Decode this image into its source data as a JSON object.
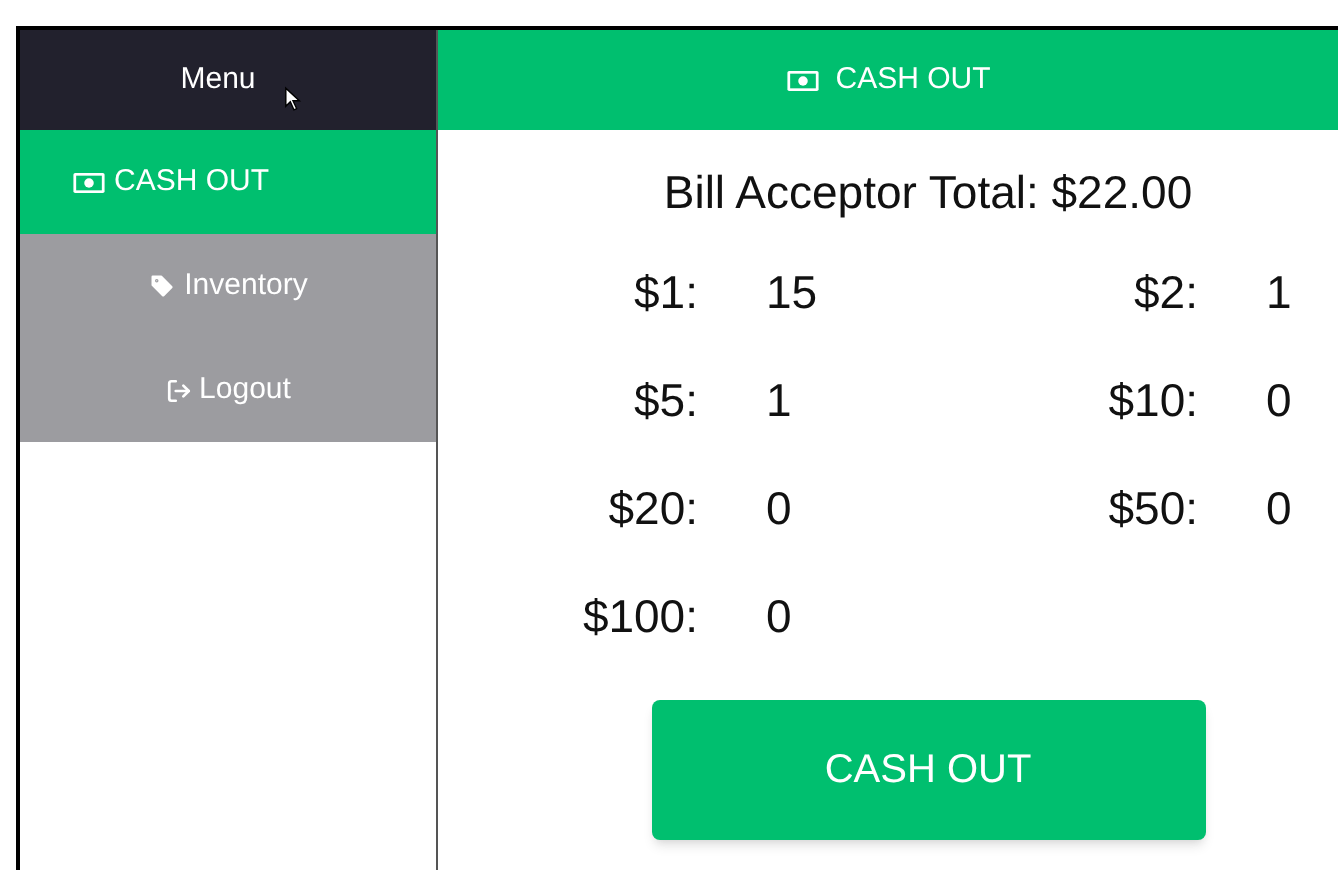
{
  "sidebar": {
    "title": "Menu",
    "items": [
      {
        "label": "CASH OUT",
        "selected": true
      },
      {
        "label": "Inventory",
        "selected": false
      },
      {
        "label": "Logout",
        "selected": false
      }
    ]
  },
  "header": {
    "title": "CASH OUT"
  },
  "total": "Bill Acceptor Total: $22.00",
  "bills": [
    {
      "label": "$1:",
      "count": "15"
    },
    {
      "label": "$2:",
      "count": "1"
    },
    {
      "label": "$5:",
      "count": "1"
    },
    {
      "label": "$10:",
      "count": "0"
    },
    {
      "label": "$20:",
      "count": "0"
    },
    {
      "label": "$50:",
      "count": "0"
    },
    {
      "label": "$100:",
      "count": "0"
    }
  ],
  "button": "CASH OUT"
}
